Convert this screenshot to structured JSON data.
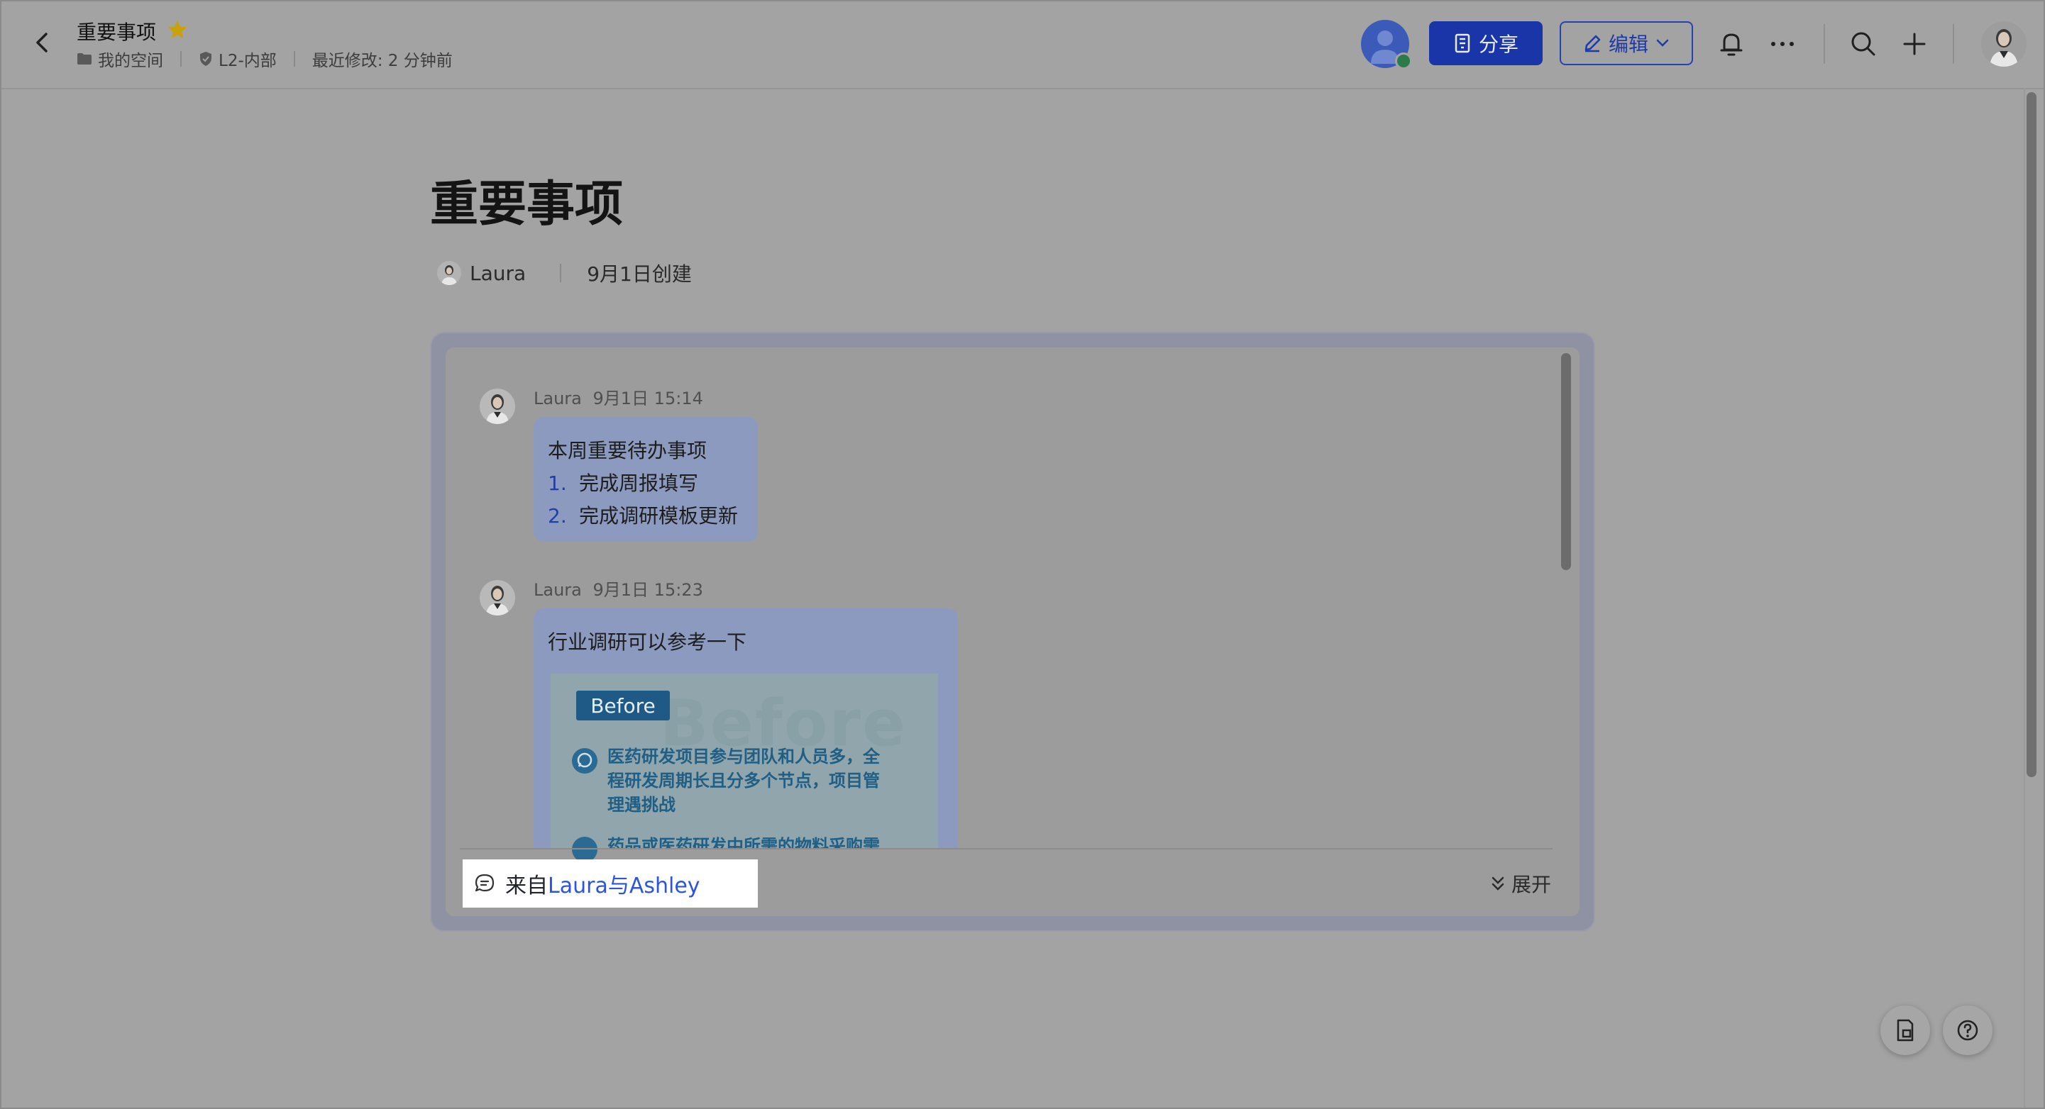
{
  "header": {
    "doc_title": "重要事项",
    "breadcrumbs": [
      "我的空间",
      "L2-内部",
      "最近修改: 2 分钟前"
    ],
    "share_label": "分享",
    "edit_label": "编辑"
  },
  "document": {
    "title": "重要事项",
    "author": "Laura",
    "created": "9月1日创建"
  },
  "messages": [
    {
      "sender": "Laura",
      "time": "9月1日 15:14",
      "text": "本周重要待办事项",
      "list": [
        {
          "num": "1.",
          "text": "完成周报填写"
        },
        {
          "num": "2.",
          "text": "完成调研模板更新"
        }
      ]
    },
    {
      "sender": "Laura",
      "time": "9月1日 15:23",
      "text": "行业调研可以参考一下",
      "image": {
        "watermark": "Before",
        "tag": "Before",
        "bullet1_lines": [
          "医药研发项目参与团队和人员多，全",
          "程研发周期长且分多个节点，项目管",
          "理遇挑战"
        ],
        "bullet2_line": "药品或医药研发中所需的物料采购需"
      }
    }
  ],
  "footer": {
    "source_prefix": "来自",
    "source_names": "Laura与Ashley",
    "expand_label": "展开"
  },
  "icons": [
    "back-arrow-icon",
    "star-icon",
    "folder-icon",
    "shield-icon",
    "building-icon",
    "pencil-icon",
    "chevron-down-icon",
    "bell-icon",
    "more-icon",
    "search-icon",
    "plus-icon",
    "chat-bubble-icon",
    "double-chevron-down-icon",
    "document-icon",
    "help-icon"
  ],
  "colors": {
    "accent": "#1a35a8",
    "star": "#c9a10a",
    "link": "#2b55e0"
  }
}
